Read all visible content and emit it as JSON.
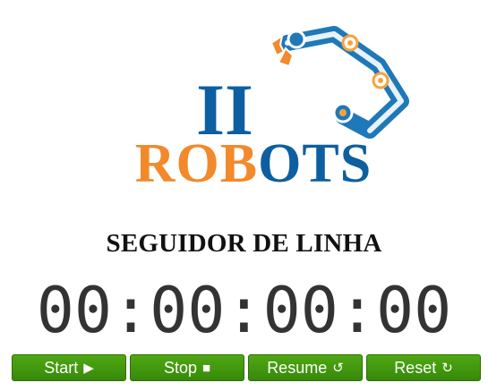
{
  "logo": {
    "top_text": "II",
    "bottom_text_orange": "ROB",
    "bottom_text_blue": "OTS",
    "colors": {
      "blue": "#0d5fa0",
      "orange": "#f2892b",
      "arm_blue": "#1f78b8",
      "arm_orange": "#f7a23c"
    }
  },
  "title": "SEGUIDOR DE LINHA",
  "timer": "00:00:00:00",
  "controls": {
    "start": {
      "label": "Start",
      "icon": "▶"
    },
    "stop": {
      "label": "Stop",
      "icon": "■"
    },
    "resume": {
      "label": "Resume",
      "icon": "↺"
    },
    "reset": {
      "label": "Reset",
      "icon": "↻"
    }
  },
  "colors": {
    "button_green": "#3e9a0d",
    "text_dark": "#111111",
    "timer_text": "#333333"
  }
}
